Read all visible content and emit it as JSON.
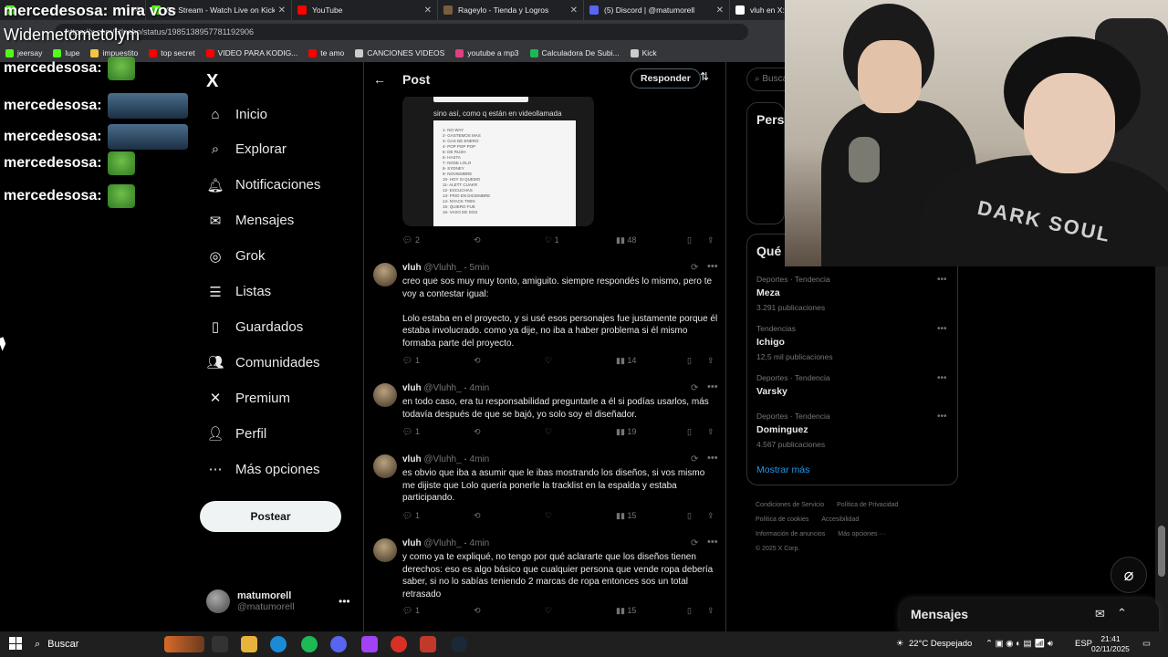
{
  "browser": {
    "tabs": [
      {
        "label": "",
        "color": "#53fc18"
      },
      {
        "label": "Qc Stream - Watch Live on Kick",
        "color": "#53fc18"
      },
      {
        "label": "YouTube",
        "color": "#ff0000"
      },
      {
        "label": "Rageylo - Tienda y Logros",
        "color": "#7a5c3e"
      },
      {
        "label": "(5) Discord | @matumorell",
        "color": "#5865f2"
      },
      {
        "label": "vluh en X:",
        "color": "#ffffff"
      }
    ],
    "url": "https://x.com/6tlncho/status/1985138957781192906",
    "bookmarks": [
      {
        "label": "jeersay",
        "color": "#53fc18"
      },
      {
        "label": "lupe",
        "color": "#53fc18"
      },
      {
        "label": "impuestito",
        "color": "#f4c542"
      },
      {
        "label": "top secret",
        "color": "#ff0000"
      },
      {
        "label": "VIDEO PARA KODIG...",
        "color": "#ff0000"
      },
      {
        "label": "te amo",
        "color": "#ff0000"
      },
      {
        "label": "CANCIONES VIDEOS",
        "color": "#cccccc"
      },
      {
        "label": "youtube a mp3",
        "color": "#e04080"
      },
      {
        "label": "Calculadora De Subi...",
        "color": "#1db954"
      },
      {
        "label": "Kick",
        "color": "#cccccc"
      }
    ]
  },
  "overlay": {
    "title": "mercedesosa: mira vos",
    "subtitle": "Widemetometolym",
    "chat": [
      {
        "user": "mercedesosa:",
        "emote": "frog"
      },
      {
        "user": "mercedesosa:",
        "emote": "face"
      },
      {
        "user": "mercedesosa:",
        "emote": "face"
      },
      {
        "user": "mercedesosa:",
        "emote": "frog"
      },
      {
        "user": "mercedesosa:",
        "emote": "frog"
      }
    ]
  },
  "nav": {
    "logo": "X",
    "items": [
      {
        "label": "Inicio",
        "icon": "home-icon",
        "glyph": "⌂"
      },
      {
        "label": "Explorar",
        "icon": "search-icon",
        "glyph": "⌕"
      },
      {
        "label": "Notificaciones",
        "icon": "bell-icon",
        "glyph": "🔔︎"
      },
      {
        "label": "Mensajes",
        "icon": "mail-icon",
        "glyph": "✉"
      },
      {
        "label": "Grok",
        "icon": "grok-icon",
        "glyph": "◎"
      },
      {
        "label": "Listas",
        "icon": "list-icon",
        "glyph": "☰"
      },
      {
        "label": "Guardados",
        "icon": "bookmark-icon",
        "glyph": "▯"
      },
      {
        "label": "Comunidades",
        "icon": "people-icon",
        "glyph": "👥︎"
      },
      {
        "label": "Premium",
        "icon": "x-icon",
        "glyph": "✕"
      },
      {
        "label": "Perfil",
        "icon": "person-icon",
        "glyph": "👤︎"
      },
      {
        "label": "Más opciones",
        "icon": "more-circle-icon",
        "glyph": "⋯"
      }
    ],
    "post_label": "Postear",
    "account": {
      "name": "matumorell",
      "handle": "@matumorell"
    }
  },
  "post": {
    "header": "Post",
    "respond_label": "Responder",
    "image_caption": "sino así, como q están en videollamada",
    "image_doc_lines": [
      "1- NO WAY",
      "2- GASTEMOS MAS",
      "3- GAS DE ENERO",
      "4- POP POP POP",
      "5- DE RUSH",
      "6- HASTA",
      "7- NOSE LOLO",
      "8- SYDNEY",
      "9- NOVIEMBRE",
      "10- HOY SI QUEMO",
      "11- ALETT CUAKR",
      "12- ESCUCHAS",
      "13- FRIO EN DICIEMBRE",
      "14- NYACK TWIN",
      "15- QUIERO FUE",
      "16- VASO DE DOS"
    ],
    "top_actions": {
      "replies": "2",
      "likes": "1",
      "views": "48"
    },
    "replies": [
      {
        "name": "vluh",
        "handle": "@Vluhh_",
        "time": "5min",
        "text": "creo que sos muy muy tonto, amiguito. siempre respondés lo mismo, pero te voy a contestar igual:\n\nLolo estaba en el proyecto, y si usé esos personajes fue justamente porque él estaba involucrado. como ya dije, no iba a haber problema si él mismo formaba parte del proyecto.",
        "replies": "1",
        "views": "14"
      },
      {
        "name": "vluh",
        "handle": "@Vluhh_",
        "time": "4min",
        "text": "en todo caso, era tu responsabilidad preguntarle a él si podías usarlos, más todavía después de que se bajó, yo solo soy el diseñador.",
        "replies": "1",
        "views": "19"
      },
      {
        "name": "vluh",
        "handle": "@Vluhh_",
        "time": "4min",
        "text": "es obvio que iba a asumir que le ibas mostrando los diseños, si vos mismo me dijiste que Lolo quería ponerle la tracklist en la espalda y estaba participando.",
        "replies": "1",
        "views": "15"
      },
      {
        "name": "vluh",
        "handle": "@Vluhh_",
        "time": "4min",
        "text": "y como ya te expliqué, no tengo por qué aclararte que los diseños tienen derechos: eso es algo básico que cualquier persona que vende ropa debería saber, si no lo sabías teniendo 2 marcas de ropa entonces sos un total retrasado",
        "replies": "1",
        "views": "15"
      }
    ]
  },
  "sidebar": {
    "search_placeholder": "Buscar",
    "people_title": "Perso",
    "trends_title": "Qué o",
    "trends": [
      {
        "category": "Deportes · Tendencia",
        "name": "Meza",
        "count": "3.291 publicaciones"
      },
      {
        "category": "Tendencias",
        "name": "Ichigo",
        "count": "12,5 mil publicaciones"
      },
      {
        "category": "Deportes · Tendencia",
        "name": "Varsky",
        "count": ""
      },
      {
        "category": "Deportes · Tendencia",
        "name": "Dominguez",
        "count": "4.567 publicaciones"
      }
    ],
    "show_more": "Mostrar más",
    "footer": [
      "Condiciones de Servicio",
      "Política de Privacidad",
      "Política de cookies",
      "Accesibilidad",
      "Información de anuncios",
      "Más opciones ···",
      "© 2025 X Corp."
    ]
  },
  "messages_dock": {
    "title": "Mensajes"
  },
  "taskbar": {
    "search_label": "Buscar",
    "weather": "22°C  Despejado",
    "lang": "ESP",
    "time": "21:41",
    "date": "02/11/2025"
  },
  "webcam": {
    "shirt_text": "DARK SOUL"
  }
}
